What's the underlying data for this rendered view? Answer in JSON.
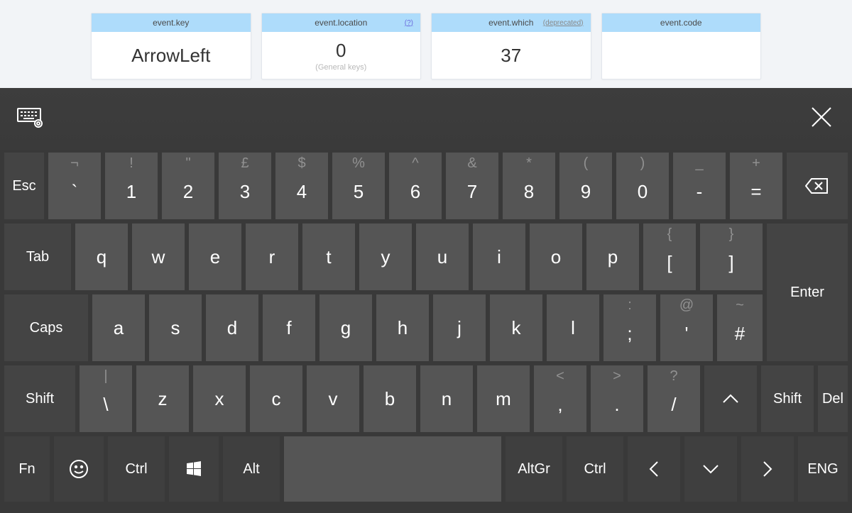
{
  "cards": {
    "key": {
      "title": "event.key",
      "value": "ArrowLeft",
      "sub": "",
      "extra": ""
    },
    "location": {
      "title": "event.location",
      "value": "0",
      "sub": "(General keys)",
      "extra": "(?)"
    },
    "which": {
      "title": "event.which",
      "value": "37",
      "sub": "",
      "extra": "(deprecated)"
    },
    "code": {
      "title": "event.code",
      "value": "",
      "sub": "",
      "extra": ""
    }
  },
  "keyboard": {
    "row1": {
      "esc": "Esc",
      "backtick": {
        "shift": "¬",
        "main": "`"
      },
      "1": {
        "shift": "!",
        "main": "1"
      },
      "2": {
        "shift": "\"",
        "main": "2"
      },
      "3": {
        "shift": "£",
        "main": "3"
      },
      "4": {
        "shift": "$",
        "main": "4"
      },
      "5": {
        "shift": "%",
        "main": "5"
      },
      "6": {
        "shift": "^",
        "main": "6"
      },
      "7": {
        "shift": "&",
        "main": "7"
      },
      "8": {
        "shift": "*",
        "main": "8"
      },
      "9": {
        "shift": "(",
        "main": "9"
      },
      "0": {
        "shift": ")",
        "main": "0"
      },
      "minus": {
        "shift": "_",
        "main": "-"
      },
      "equal": {
        "shift": "+",
        "main": "="
      }
    },
    "row2": {
      "tab": "Tab",
      "q": "q",
      "w": "w",
      "e": "e",
      "r": "r",
      "t": "t",
      "y": "y",
      "u": "u",
      "i": "i",
      "o": "o",
      "p": "p",
      "lbrack": {
        "shift": "{",
        "main": "["
      },
      "rbrack": {
        "shift": "}",
        "main": "]"
      }
    },
    "enter": "Enter",
    "row3": {
      "caps": "Caps",
      "a": "a",
      "s": "s",
      "d": "d",
      "f": "f",
      "g": "g",
      "h": "h",
      "j": "j",
      "k": "k",
      "l": "l",
      "semi": {
        "shift": ":",
        "main": ";"
      },
      "quote": {
        "shift": "@",
        "main": "'"
      },
      "hash": {
        "shift": "~",
        "main": "#"
      }
    },
    "row4": {
      "lshift": "Shift",
      "bslash": {
        "shift": "|",
        "main": "\\"
      },
      "z": "z",
      "x": "x",
      "c": "c",
      "v": "v",
      "b": "b",
      "n": "n",
      "m": "m",
      "comma": {
        "shift": "<",
        "main": ","
      },
      "period": {
        "shift": ">",
        "main": "."
      },
      "slash": {
        "shift": "?",
        "main": "/"
      },
      "rshift": "Shift",
      "del": "Del"
    },
    "row5": {
      "fn": "Fn",
      "ctrl_l": "Ctrl",
      "alt": "Alt",
      "altgr": "AltGr",
      "ctrl_r": "Ctrl",
      "lang": "ENG"
    }
  }
}
